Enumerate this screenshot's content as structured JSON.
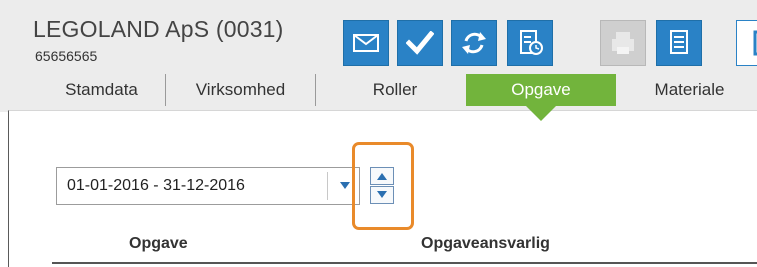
{
  "header": {
    "company_name": "LEGOLAND ApS (0031)",
    "company_number": "65656565"
  },
  "toolbar": {
    "icons": [
      {
        "name": "mail-icon",
        "color": "#2a82c6"
      },
      {
        "name": "checkmark-icon",
        "color": "#2a82c6"
      },
      {
        "name": "refresh-icon",
        "color": "#2a82c6"
      },
      {
        "name": "document-clock-icon",
        "color": "#2a82c6"
      },
      {
        "name": "printer-icon",
        "color": "#cfcfcf"
      },
      {
        "name": "document-icon",
        "color": "#2a82c6"
      },
      {
        "name": "partial-icon",
        "color": "#2a82c6"
      }
    ]
  },
  "tabs": [
    {
      "label": "Stamdata",
      "active": false
    },
    {
      "label": "Virksomhed",
      "active": false
    },
    {
      "label": "Roller",
      "active": false
    },
    {
      "label": "Opgave",
      "active": true
    },
    {
      "label": "Materiale",
      "active": false
    }
  ],
  "filter": {
    "period": "01-01-2016 - 31-12-2016"
  },
  "table": {
    "columns": [
      "Opgave",
      "Opgaveansvarlig"
    ]
  },
  "colors": {
    "accent_blue": "#2a82c6",
    "active_tab_green": "#72b43c",
    "highlight_orange": "#e98a2a"
  }
}
